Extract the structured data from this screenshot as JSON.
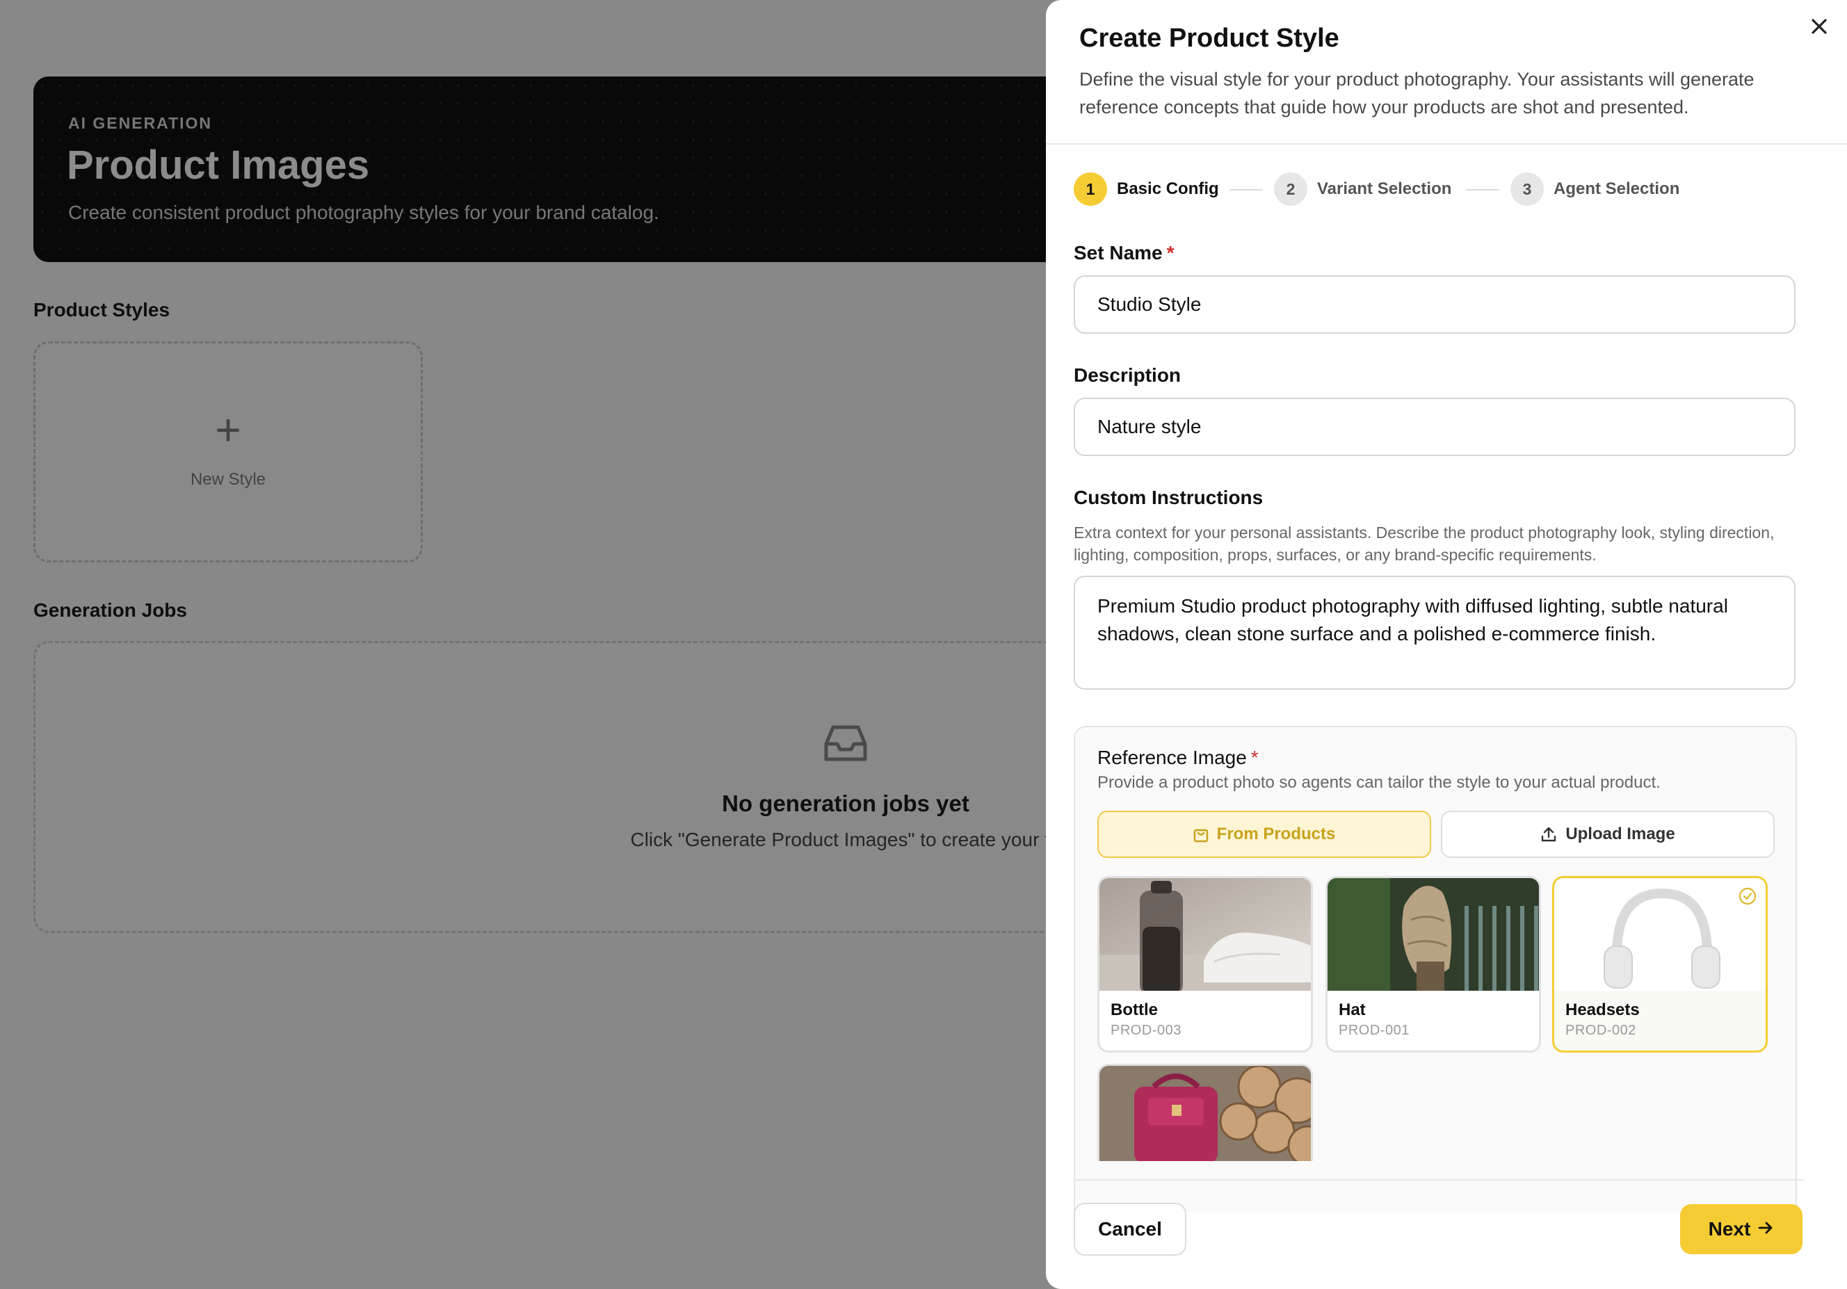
{
  "background": {
    "hero": {
      "eyebrow": "AI GENERATION",
      "title": "Product Images",
      "subtitle": "Create consistent product photography styles for your brand catalog."
    },
    "product_styles_title": "Product Styles",
    "new_style_label": "New Style",
    "generation_jobs_title": "Generation Jobs",
    "empty_state": {
      "icon": "inbox-icon",
      "title": "No generation jobs yet",
      "subtitle": "Click \"Generate Product Images\" to create your fir"
    }
  },
  "drawer": {
    "title": "Create Product Style",
    "description": "Define the visual style for your product photography. Your assistants will generate reference concepts that guide how your products are shot and presented.",
    "close_icon": "close-icon",
    "steps": [
      {
        "number": "1",
        "label": "Basic Config",
        "state": "active"
      },
      {
        "number": "2",
        "label": "Variant Selection",
        "state": "idle"
      },
      {
        "number": "3",
        "label": "Agent Selection",
        "state": "idle"
      }
    ],
    "set_name": {
      "label": "Set Name",
      "required": "*",
      "value": "Studio Style"
    },
    "description_field": {
      "label": "Description",
      "value": "Nature style"
    },
    "custom_instructions": {
      "label": "Custom Instructions",
      "help": "Extra context for your personal assistants. Describe the product photography look, styling direction, lighting, composition, props, surfaces, or any brand-specific requirements.",
      "value": "Premium Studio product photography with diffused lighting, subtle natural shadows, clean stone surface and a polished e-commerce finish."
    },
    "reference_image": {
      "label": "Reference Image",
      "required": "*",
      "subtitle": "Provide a product photo so agents can tailor the style to your actual product.",
      "from_products_label": "From Products",
      "upload_label": "Upload Image",
      "products": [
        {
          "name": "Bottle",
          "sku": "PROD-003",
          "selected": false
        },
        {
          "name": "Hat",
          "sku": "PROD-001",
          "selected": false
        },
        {
          "name": "Headsets",
          "sku": "PROD-002",
          "selected": true
        }
      ]
    },
    "footer": {
      "cancel_label": "Cancel",
      "next_label": "Next",
      "next_icon": "arrow-right-icon"
    }
  },
  "colors": {
    "accent": "#f5cc33",
    "required": "#d12f2f",
    "overlay": "rgba(0,0,0,0.45)"
  }
}
